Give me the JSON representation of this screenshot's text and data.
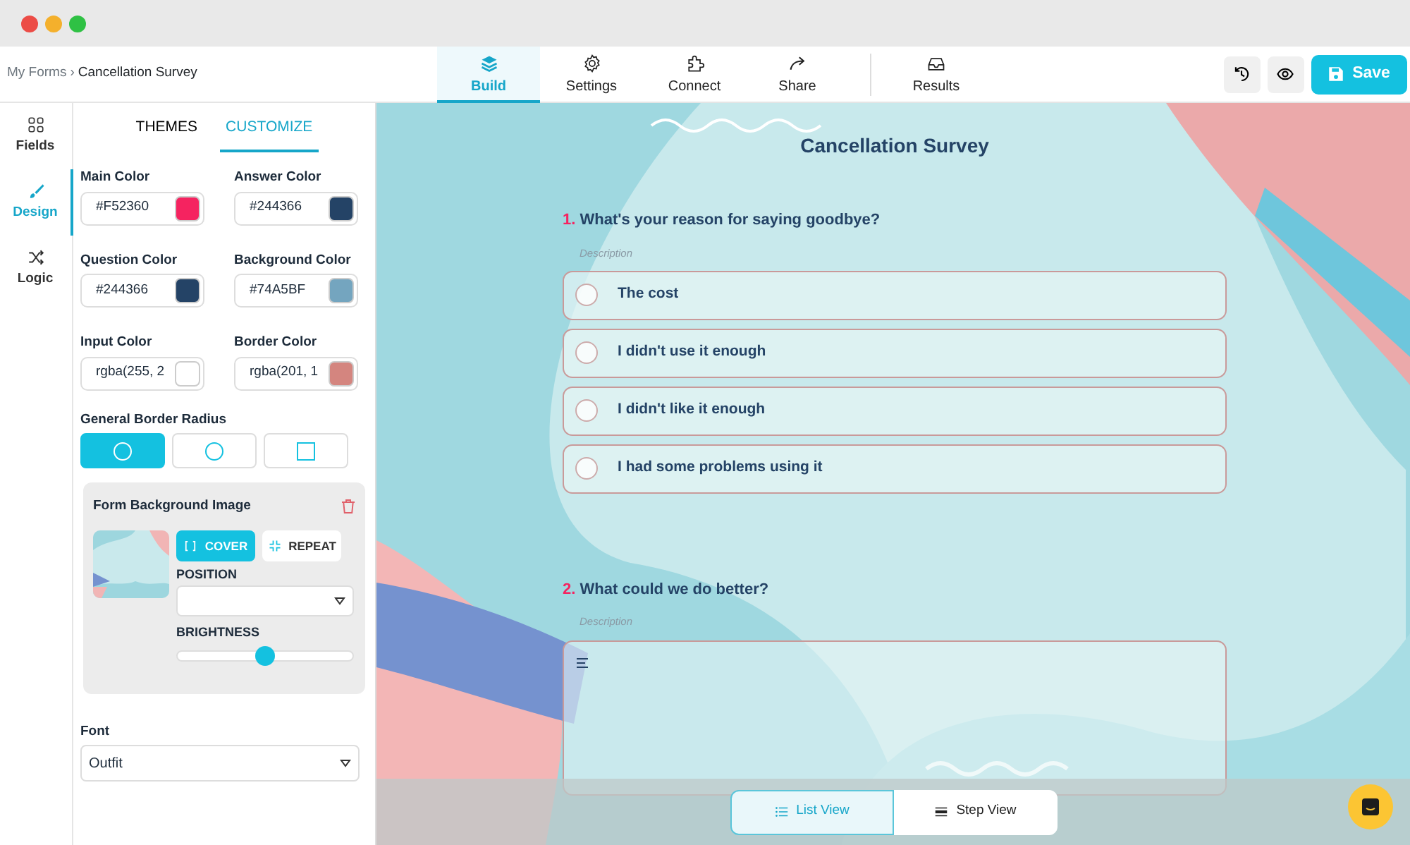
{
  "breadcrumb": {
    "items": [
      "My Forms",
      "Cancellation Survey"
    ],
    "separator": "›"
  },
  "nav_tabs": [
    {
      "label": "Build",
      "selected": true
    },
    {
      "label": "Settings",
      "selected": false
    },
    {
      "label": "Connect",
      "selected": false
    },
    {
      "label": "Share",
      "selected": false
    },
    {
      "label": "Results",
      "selected": false
    }
  ],
  "header_actions": [
    {
      "kind": "icon"
    },
    {
      "kind": "icon"
    },
    {
      "kind": "primary",
      "label": "Save"
    }
  ],
  "rail": [
    {
      "label": "Fields",
      "selected": false
    },
    {
      "label": "Design",
      "selected": true
    },
    {
      "label": "Logic",
      "selected": false
    }
  ],
  "panel_tabs": [
    {
      "label": "THEMES",
      "selected": false
    },
    {
      "label": "CUSTOMIZE",
      "selected": true
    }
  ],
  "colors": [
    {
      "label": "Main Color",
      "value": "#F52360",
      "color": "#f52360"
    },
    {
      "label": "Answer Color",
      "value": "#244366",
      "color": "#244366"
    },
    {
      "label": "Question Color",
      "value": "#244366",
      "color": "#244366"
    },
    {
      "label": "Background Color",
      "value": "#74A5BF",
      "color": "#74a5bf"
    },
    {
      "label": "Input Color",
      "value": "rgba(255, 2",
      "color": "#ffffff"
    },
    {
      "label": "Border Color",
      "value": "rgba(201, 1",
      "color": "#d4857f"
    }
  ],
  "border_radius": {
    "label": "General Border Radius",
    "options": [
      {
        "kind": "circle",
        "selected": true
      },
      {
        "kind": "circle",
        "selected": false
      },
      {
        "kind": "square",
        "selected": false
      }
    ]
  },
  "background_image": {
    "title": "Form Background Image",
    "modes": [
      {
        "label": "COVER",
        "selected": true
      },
      {
        "label": "REPEAT",
        "selected": false
      }
    ],
    "position_label": "POSITION",
    "brightness_label": "BRIGHTNESS",
    "brightness": {
      "level": 0.5
    }
  },
  "font": {
    "label": "Font",
    "value": "Outfit"
  },
  "form": {
    "title": "Cancellation Survey",
    "questions": [
      {
        "number": "1.",
        "text": "What's your reason for saying goodbye?",
        "description": "Description",
        "kind": "choice",
        "options": [
          {
            "label": "The cost",
            "selected": false
          },
          {
            "label": "I didn't use it enough",
            "selected": false
          },
          {
            "label": "I didn't like it enough",
            "selected": false
          },
          {
            "label": "I had some problems using it",
            "selected": false
          }
        ]
      },
      {
        "number": "2.",
        "text": "What could we do better?",
        "description": "Description",
        "kind": "text"
      }
    ]
  },
  "view_toggle": [
    {
      "label": "List View",
      "selected": true
    },
    {
      "label": "Step View",
      "selected": false
    }
  ]
}
